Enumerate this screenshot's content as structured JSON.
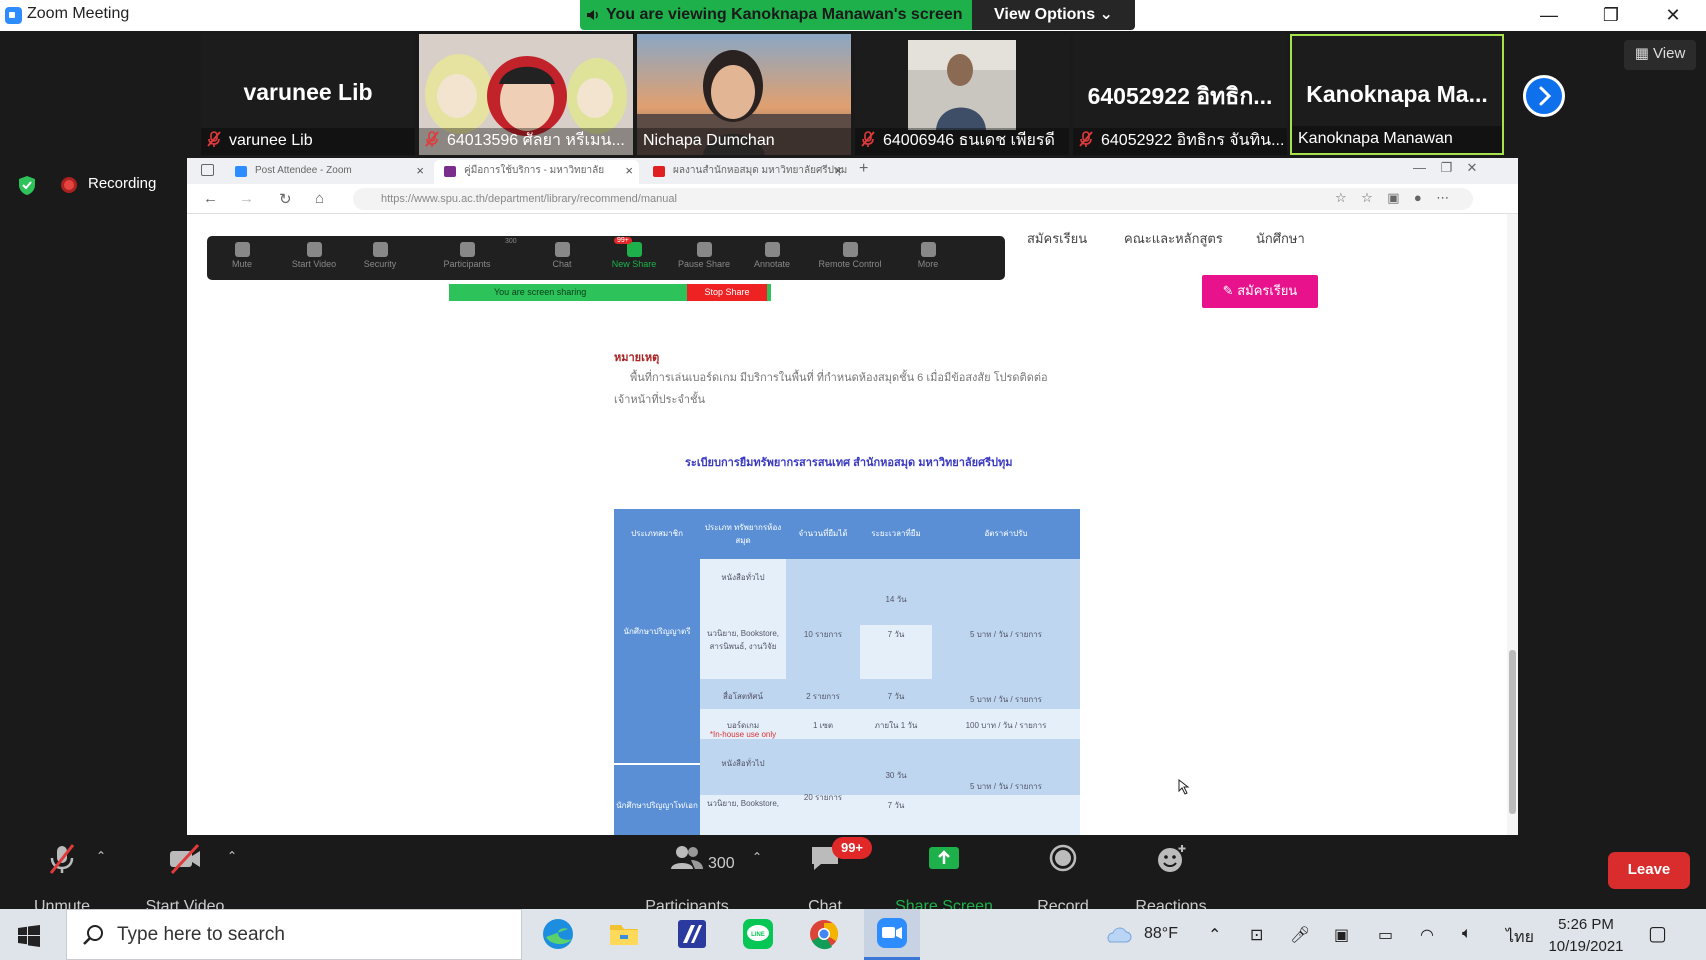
{
  "window": {
    "title": "Zoom Meeting",
    "minimize": "—",
    "restore": "❐",
    "close": "✕"
  },
  "banner": {
    "sharing_text": "You are viewing Kanoknapa Manawan's screen",
    "view_options": "View Options ⌄"
  },
  "gallery": {
    "tiles": [
      {
        "big": "varunee Lib",
        "caption": "varunee Lib",
        "muted": true
      },
      {
        "big": "",
        "caption": "64013596 ศัลยา หรีเมน...",
        "muted": true
      },
      {
        "big": "",
        "caption": "Nichapa Dumchan",
        "muted": false
      },
      {
        "big": "",
        "caption": "64006946 ธนเดช เพียรดี",
        "muted": true
      },
      {
        "big": "64052922 อิทธิก...",
        "caption": "64052922 อิทธิกร จันทิน...",
        "muted": true
      },
      {
        "big": "Kanoknapa Ma...",
        "caption": "Kanoknapa Manawan",
        "muted": false
      }
    ],
    "view_label": "View"
  },
  "recording": {
    "label": "Recording"
  },
  "browser": {
    "tabs": [
      {
        "label": "Post Attendee - Zoom",
        "color": "#2d8cff"
      },
      {
        "label": "คู่มือการใช้บริการ - มหาวิทยาลัย",
        "color": "#7a2d8c"
      },
      {
        "label": "ผลงานสำนักหอสมุด มหาวิทยาลัยศรีปทุม",
        "color": "#e02020"
      }
    ],
    "url": "https://www.spu.ac.th/department/library/recommend/manual"
  },
  "inner_toolbar": {
    "items": [
      "Mute",
      "Start Video",
      "Security",
      "Participants",
      "Chat",
      "New Share",
      "Pause Share",
      "Annotate",
      "Remote Control",
      "More"
    ],
    "participants_count": "300",
    "chat_badge": "99+",
    "sharing_text": "You are screen sharing",
    "stop_share": "Stop Share"
  },
  "website": {
    "menu": [
      "สมัครเรียน",
      "คณะและหลักสูตร",
      "นักศึกษา"
    ],
    "enroll_button": "สมัครเรียน",
    "note_title": "หมายเหตุ",
    "note_lines": [
      "พื้นที่การเล่นเบอร์ดเกม มีบริการในพื้นที่ ที่กำหนดห้องสมุดชั้น 6 เมื่อมีข้อสงสัย โปรดติดต่อ",
      "เจ้าหน้าที่ประจำชั้น"
    ],
    "rules_title": "ระเบียบการยืมทรัพยากรสารสนเทศ สำนักหอสมุด มหาวิทยาลัยศรีปทุม",
    "table": {
      "headers": [
        "ประเภทสมาชิก",
        "ประเภท ทรัพยากรห้องสมุด",
        "จำนวนที่ยืมได้",
        "ระยะเวลาที่ยืม",
        "อัตราค่าปรับ"
      ],
      "member_1": "นักศึกษาปริญญาตรี",
      "member_2": "นักศึกษาปริญญาโท/เอก",
      "cells": [
        "หนังสือทั่วไป",
        "14 วัน",
        "นวนิยาย, Bookstore, สารนิพนธ์, งานวิจัย",
        "10 รายการ",
        "7 วัน",
        "5 บาท / วัน / รายการ",
        "สื่อโสตทัศน์",
        "2 รายการ",
        "7 วัน",
        "5 บาท / วัน / รายการ",
        "บอร์ดเกม",
        "1 เซต",
        "ภายใน 1 วัน",
        "100 บาท / วัน / รายการ",
        "*In-house use only",
        "หนังสือทั่วไป",
        "30 วัน",
        "นวนิยาย, Bookstore,",
        "20 รายการ",
        "7 วัน",
        "5 บาท / วัน / รายการ"
      ]
    }
  },
  "controls": {
    "unmute": "Unmute",
    "start_video": "Start Video",
    "participants": "Participants",
    "participants_count": "300",
    "chat": "Chat",
    "chat_badge": "99+",
    "share_screen": "Share Screen",
    "record": "Record",
    "reactions": "Reactions",
    "leave": "Leave"
  },
  "taskbar": {
    "search_placeholder": "Type here to search",
    "temperature": "88°F",
    "language": "ไทย",
    "time": "5:26 PM",
    "date": "10/19/2021"
  },
  "colors": {
    "zoom_blue": "#2d8cff",
    "share_green": "#1eb14b",
    "leave_red": "#d92d2d",
    "website_pink": "#e8138c",
    "table_blue": "#5a8fd6"
  }
}
